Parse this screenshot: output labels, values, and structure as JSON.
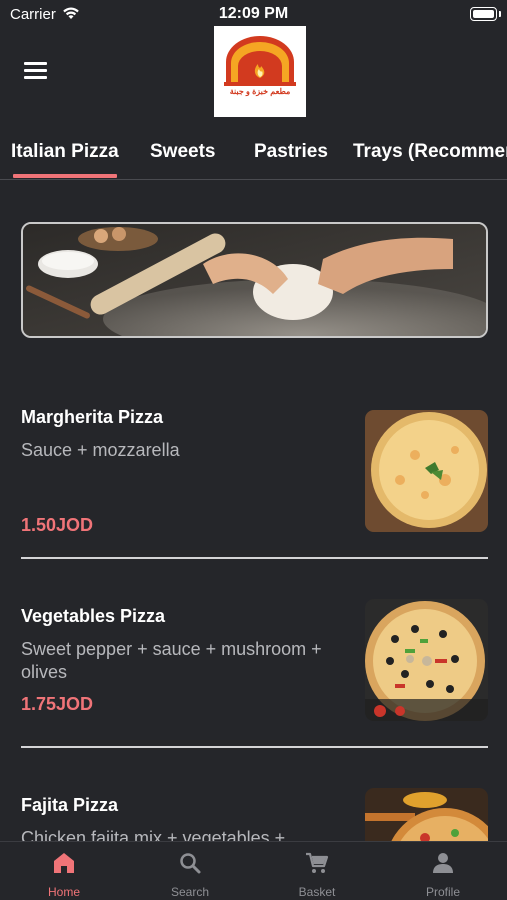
{
  "status_bar": {
    "carrier": "Carrier",
    "time": "12:09 PM"
  },
  "header": {
    "logo_text": "مطعم خبزة و جبنة",
    "menu_icon": "hamburger-menu-icon"
  },
  "categories": [
    {
      "label": "Italian Pizza",
      "active": true
    },
    {
      "label": "Sweets"
    },
    {
      "label": "Pastries"
    },
    {
      "label": "Trays (Recommended)"
    }
  ],
  "items": [
    {
      "name": "Margherita Pizza",
      "description": "Sauce + mozzarella",
      "price": "1.50JOD"
    },
    {
      "name": "Vegetables Pizza",
      "description": "Sweet pepper + sauce + mushroom + olives",
      "price": "1.75JOD"
    },
    {
      "name": "Fajita Pizza",
      "description": "Chicken fajita mix + vegetables +",
      "price": ""
    }
  ],
  "tabbar": [
    {
      "label": "Home",
      "icon": "home-icon",
      "active": true
    },
    {
      "label": "Search",
      "icon": "search-icon"
    },
    {
      "label": "Basket",
      "icon": "cart-icon"
    },
    {
      "label": "Profile",
      "icon": "profile-icon"
    }
  ],
  "colors": {
    "accent": "#f07478",
    "background": "#25262a",
    "logo_red": "#d23a1f",
    "logo_orange": "#f5a623"
  }
}
